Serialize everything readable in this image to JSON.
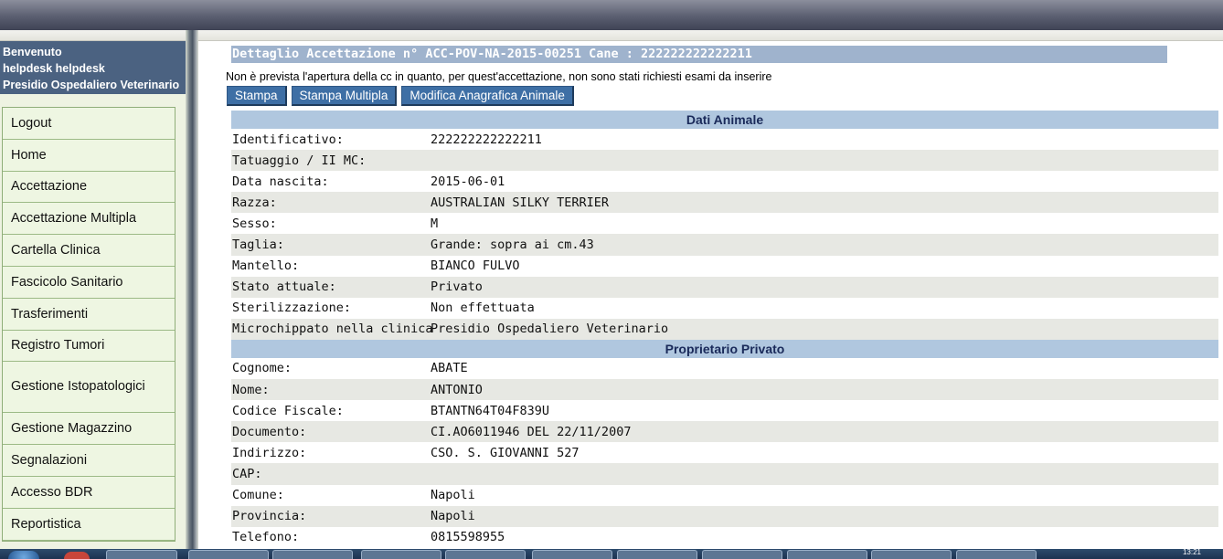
{
  "user_box": {
    "line1": "Benvenuto",
    "line2": "helpdesk helpdesk",
    "line3": "Presidio Ospedaliero Veterinario"
  },
  "menu": [
    "Logout",
    "Home",
    "Accettazione",
    "Accettazione Multipla",
    "Cartella Clinica",
    "Fascicolo Sanitario",
    "Trasferimenti",
    "Registro Tumori",
    "Gestione Istopatologici",
    "Gestione Magazzino",
    "Segnalazioni",
    "Accesso BDR",
    "Reportistica"
  ],
  "page": {
    "title": "Dettaglio Accettazione n° ACC-POV-NA-2015-00251 Cane : 222222222222211",
    "notice": "Non è prevista l'apertura della cc in quanto, per quest'accettazione, non sono stati richiesti esami da inserire",
    "buttons": {
      "stampa": "Stampa",
      "stampa_multipla": "Stampa Multipla",
      "modifica": "Modifica Anagrafica Animale"
    }
  },
  "dati_animale": {
    "header": "Dati Animale",
    "rows": [
      {
        "label": "Identificativo:",
        "value": "222222222222211"
      },
      {
        "label": "Tatuaggio / II MC:",
        "value": ""
      },
      {
        "label": "Data nascita:",
        "value": "2015-06-01"
      },
      {
        "label": "Razza:",
        "value": "AUSTRALIAN SILKY TERRIER"
      },
      {
        "label": "Sesso:",
        "value": "M"
      },
      {
        "label": "Taglia:",
        "value": "Grande: sopra ai cm.43"
      },
      {
        "label": "Mantello:",
        "value": "BIANCO FULVO"
      },
      {
        "label": "Stato attuale:",
        "value": "Privato"
      },
      {
        "label": "Sterilizzazione:",
        "value": "Non effettuata"
      },
      {
        "label": "Microchippato nella clinica",
        "value": "Presidio Ospedaliero Veterinario"
      }
    ]
  },
  "proprietario": {
    "header": "Proprietario Privato",
    "rows": [
      {
        "label": "Cognome:",
        "value": "ABATE"
      },
      {
        "label": "Nome:",
        "value": "ANTONIO"
      },
      {
        "label": "Codice Fiscale:",
        "value": "BTANTN64T04F839U"
      },
      {
        "label": "Documento:",
        "value": "CI.AO6011946 DEL 22/11/2007"
      },
      {
        "label": "Indirizzo:",
        "value": "CSO. S. GIOVANNI 527"
      },
      {
        "label": "CAP:",
        "value": ""
      },
      {
        "label": "Comune:",
        "value": "Napoli"
      },
      {
        "label": "Provincia:",
        "value": "Napoli"
      },
      {
        "label": "Telefono:",
        "value": "0815598955"
      }
    ]
  },
  "taskbar": {
    "clock": "13:21"
  }
}
